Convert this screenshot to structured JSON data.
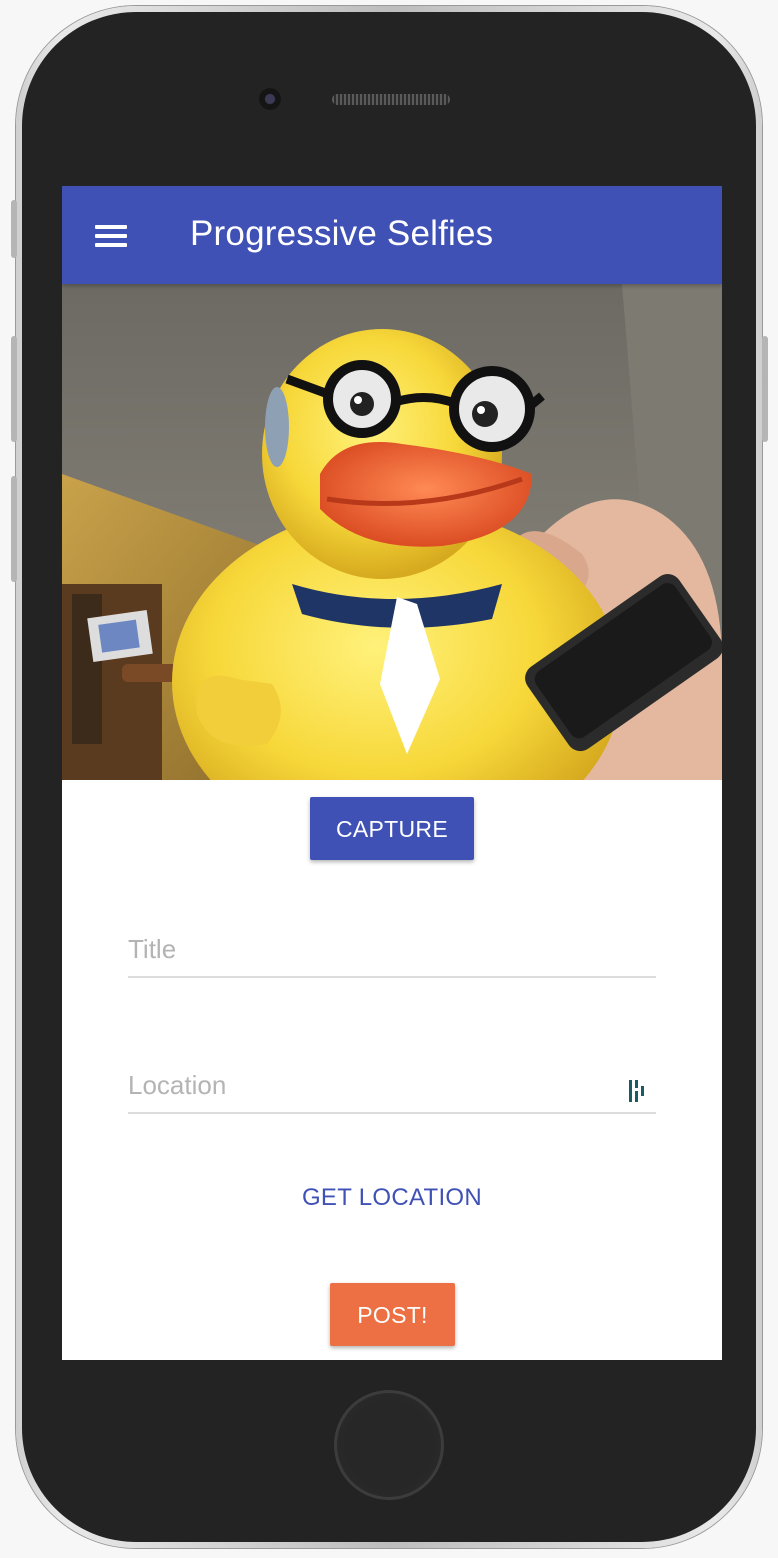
{
  "device": {
    "frame_color": "#d0d0d0",
    "body_color": "#232323"
  },
  "appbar": {
    "title": "Progressive Selfies",
    "menu_icon": "hamburger-menu-icon",
    "color": "#3f51b5"
  },
  "photo": {
    "subject": "rubber-duck-selfie"
  },
  "capture": {
    "label": "CAPTURE",
    "color": "#3f51b5"
  },
  "form": {
    "title_placeholder": "Title",
    "location_placeholder": "Location",
    "location_field_icon": "password-manager-icon"
  },
  "get_location": {
    "label": "GET LOCATION"
  },
  "post": {
    "label": "POST!",
    "color": "#ec7043"
  }
}
